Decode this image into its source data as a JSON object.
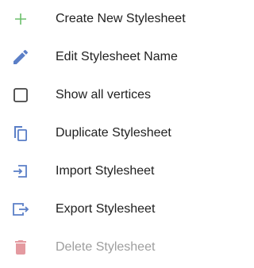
{
  "colors": {
    "text": "#212121",
    "disabled_text": "#9e9e9e",
    "create_icon": "#6bbf6b",
    "primary_icon": "#5b7fc7",
    "checkbox_icon": "#444444",
    "delete_icon": "#e49aa0"
  },
  "menu": {
    "items": [
      {
        "label": "Create New Stylesheet",
        "icon": "plus-icon",
        "enabled": true
      },
      {
        "label": "Edit Stylesheet Name",
        "icon": "pencil-icon",
        "enabled": true
      },
      {
        "label": "Show all vertices",
        "icon": "checkbox-icon",
        "checked": false,
        "enabled": true
      },
      {
        "label": "Duplicate Stylesheet",
        "icon": "copy-icon",
        "enabled": true
      },
      {
        "label": "Import Stylesheet",
        "icon": "import-icon",
        "enabled": true
      },
      {
        "label": "Export Stylesheet",
        "icon": "export-icon",
        "enabled": true
      },
      {
        "label": "Delete Stylesheet",
        "icon": "trash-icon",
        "enabled": false
      }
    ]
  }
}
